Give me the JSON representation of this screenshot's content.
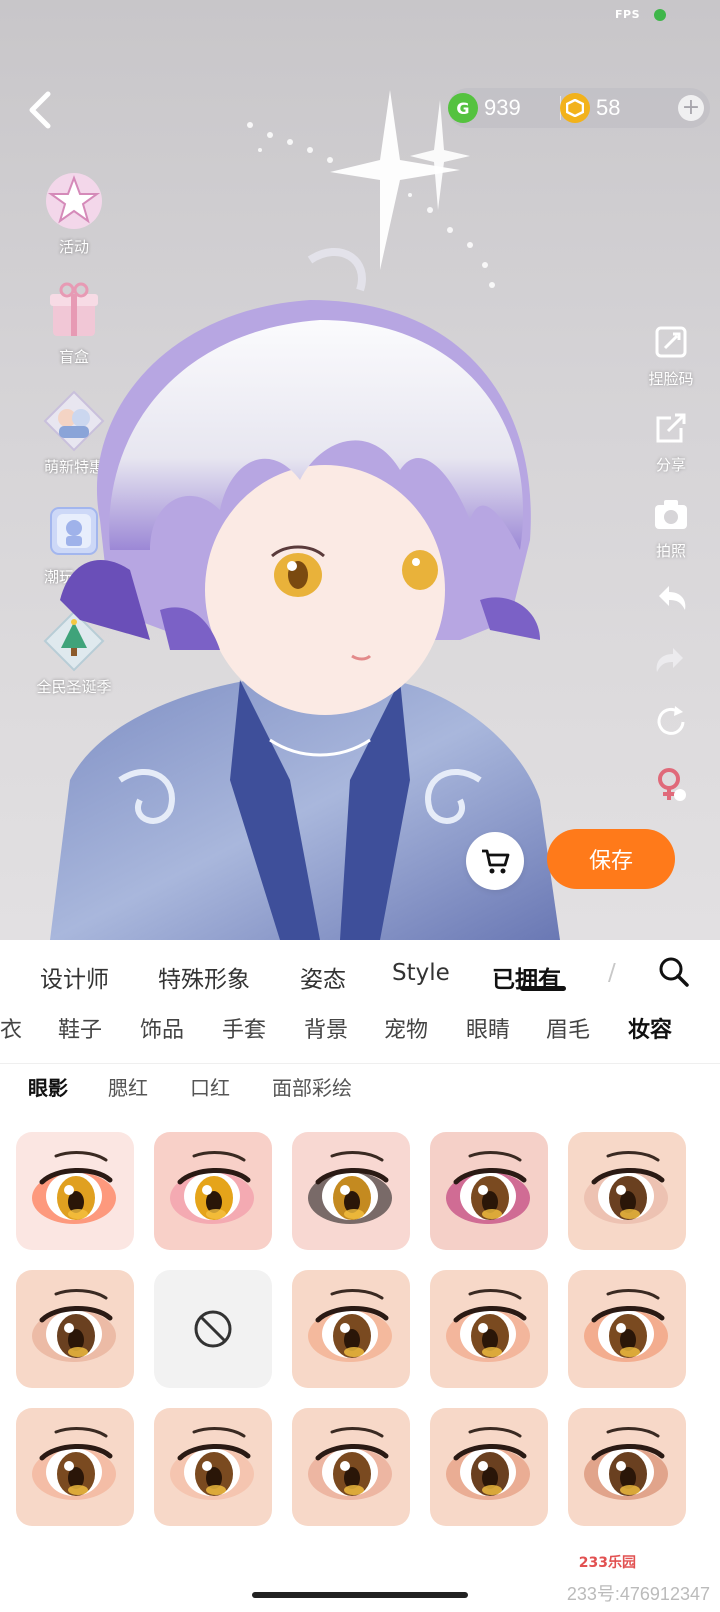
{
  "status_bar": {
    "fps_label": "FPS",
    "fps_indicator_color": "#3fb64a"
  },
  "currency": {
    "gem": {
      "icon": "g-coin-icon",
      "value": "939",
      "color": "#55c23f"
    },
    "coin": {
      "icon": "gold-coin-icon",
      "value": "58",
      "color": "#f2b21b"
    }
  },
  "left_activities": [
    {
      "icon": "star-event-icon",
      "label": "活动"
    },
    {
      "icon": "gift-box-icon",
      "label": "盲盒"
    },
    {
      "icon": "cute-special-icon",
      "label": "萌新特惠"
    },
    {
      "icon": "figure-box-icon",
      "label": "潮玩小偶"
    },
    {
      "icon": "christmas-icon",
      "label": "全民圣诞季"
    }
  ],
  "right_tools": [
    {
      "icon": "face-code-icon",
      "label": "捏脸码"
    },
    {
      "icon": "share-icon",
      "label": "分享"
    },
    {
      "icon": "camera-icon",
      "label": "拍照"
    },
    {
      "icon": "undo-icon",
      "label": ""
    },
    {
      "icon": "redo-icon",
      "label": ""
    },
    {
      "icon": "reset-icon",
      "label": ""
    },
    {
      "icon": "gender-switch-icon",
      "label": ""
    }
  ],
  "actions": {
    "save_label": "保存",
    "accent_color": "#ff7a1a"
  },
  "tabs_primary": {
    "items": [
      "设计师",
      "特殊形象",
      "姿态",
      "Style",
      "已拥有"
    ],
    "active": "已拥有",
    "overflow_fragment": "/"
  },
  "tabs_secondary": {
    "items": [
      "衣",
      "鞋子",
      "饰品",
      "手套",
      "背景",
      "宠物",
      "眼睛",
      "眉毛",
      "妆容"
    ],
    "active": "妆容"
  },
  "tabs_tertiary": {
    "items": [
      "眼影",
      "腮红",
      "口红",
      "面部彩绘"
    ],
    "active": "眼影"
  },
  "eyeshadow_grid": [
    {
      "name": "eyeshadow-red-glow"
    },
    {
      "name": "eyeshadow-pink-mole"
    },
    {
      "name": "eyeshadow-black-liner"
    },
    {
      "name": "eyeshadow-magenta"
    },
    {
      "name": "eyeshadow-natural"
    },
    {
      "name": "eyeshadow-soft-brown"
    },
    {
      "name": "eyeshadow-none"
    },
    {
      "name": "eyeshadow-peach-corner"
    },
    {
      "name": "eyeshadow-peach-wing"
    },
    {
      "name": "eyeshadow-orange-wing"
    },
    {
      "name": "eyeshadow-peach-under"
    },
    {
      "name": "eyeshadow-light-peach"
    },
    {
      "name": "eyeshadow-classic-brown"
    },
    {
      "name": "eyeshadow-warm-brown"
    },
    {
      "name": "eyeshadow-deep-brown"
    }
  ],
  "watermark": {
    "logo": "233乐园",
    "text": "233号:476912347"
  }
}
